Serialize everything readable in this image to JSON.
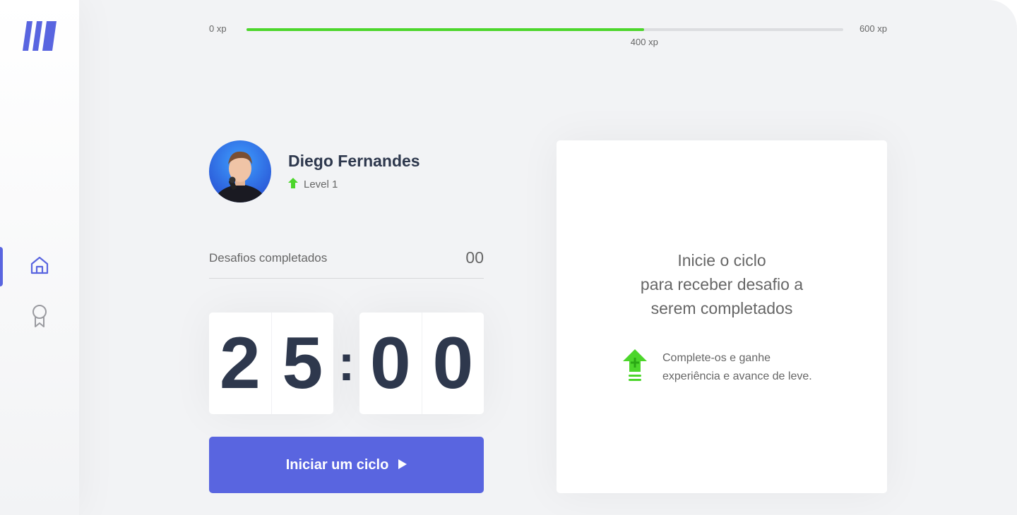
{
  "sidebar": {
    "logo_icon": "moveit-logo-icon",
    "items": [
      {
        "id": "home",
        "icon": "home-icon",
        "active": true
      },
      {
        "id": "awards",
        "icon": "award-icon",
        "active": false
      }
    ],
    "accent": "#5965e0"
  },
  "xp_bar": {
    "min_label": "0 xp",
    "max_label": "600 xp",
    "current_label": "400 xp",
    "current_value": 400,
    "max_value": 600,
    "fill_color": "#4cd62b"
  },
  "profile": {
    "name": "Diego Fernandes",
    "level_label": "Level 1",
    "level_icon": "level-up-arrow-icon"
  },
  "completed_challenges": {
    "label": "Desafios completados",
    "value": "00"
  },
  "countdown": {
    "minute_left": "2",
    "minute_right": "5",
    "separator": ":",
    "second_left": "0",
    "second_right": "0"
  },
  "start_button": {
    "label": "Iniciar um ciclo",
    "icon": "play-icon",
    "color": "#5965e0"
  },
  "challenge_box": {
    "title_lines": [
      "Inicie o ciclo",
      "para receber desafio a",
      "serem completados"
    ],
    "hint_icon": "level-up-icon",
    "hint_lines": [
      "Complete-os e ganhe",
      "experiência e avance de leve."
    ]
  }
}
